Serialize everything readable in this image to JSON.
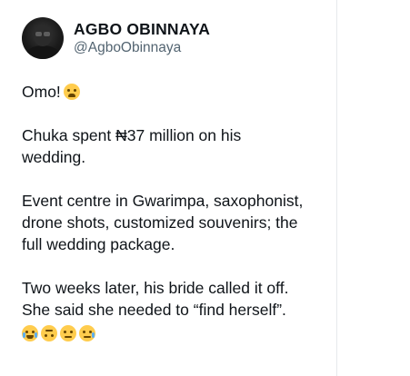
{
  "author": {
    "display_name": "AGBO OBINNAYA",
    "handle": "@AgboObinnaya"
  },
  "tweet": {
    "line1": "Omo!",
    "line1_emoji": "weary-face-emoji",
    "para2_line1": "Chuka spent ₦37 million on his",
    "para2_line2": "wedding.",
    "para3_line1": "Event centre in Gwarimpa, saxophonist,",
    "para3_line2": "drone shots, customized souvenirs; the",
    "para3_line3": "full wedding package.",
    "para4_line1": "Two weeks later, his bride called it off.",
    "para4_line2": "She said she needed to “find herself”.",
    "trailing_emojis": [
      "tears-of-joy-emoji",
      "upside-down-face-emoji",
      "confused-face-emoji",
      "crying-face-emoji"
    ]
  }
}
